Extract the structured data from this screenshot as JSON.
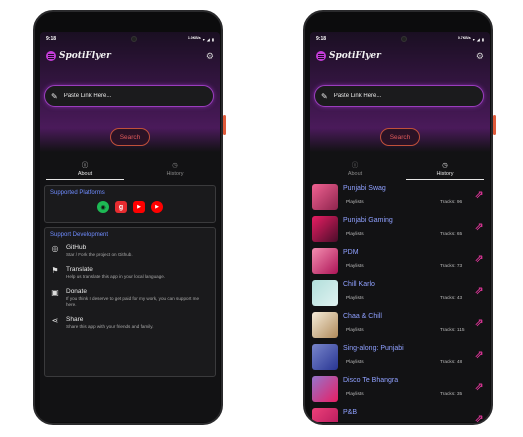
{
  "status_time": "9:18",
  "status_network": "1.0KB/s",
  "status_network_right": "0.7KB/s",
  "battery_icon": "battery-icon",
  "app_name": "SpotiFlyer",
  "search": {
    "placeholder": "Paste Link Here...",
    "button_label": "Search"
  },
  "tabs": {
    "about": "About",
    "history": "History"
  },
  "supported": {
    "title": "Supported Platforms",
    "platforms": [
      "spotify-icon",
      "gaana-icon",
      "youtube-icon",
      "youtube-music-icon"
    ]
  },
  "support_dev": {
    "title": "Support Development",
    "items": [
      {
        "name": "GitHub",
        "desc": "Star / Fork the project on Github."
      },
      {
        "name": "Translate",
        "desc": "Help us translate this app in your local language."
      },
      {
        "name": "Donate",
        "desc": "If you think I deserve to get paid for my work, you can support me here."
      },
      {
        "name": "Share",
        "desc": "Share this app with your friends and family."
      }
    ]
  },
  "history": [
    {
      "title": "Punjabi Swag",
      "type": "Playlists",
      "tracks": "Tracks: 96",
      "color": "#c2185b"
    },
    {
      "title": "Punjabi Gaming",
      "type": "Playlists",
      "tracks": "Tracks: 65",
      "color": "#d81b60"
    },
    {
      "title": "PDM",
      "type": "Playlists",
      "tracks": "Tracks: 73",
      "color": "#ec407a"
    },
    {
      "title": "Chill Karlo",
      "type": "Playlists",
      "tracks": "Tracks: 43",
      "color": "#80cbc4"
    },
    {
      "title": "Chaa & Chill",
      "type": "Playlists",
      "tracks": "Tracks: 115",
      "color": "#e8dcc8"
    },
    {
      "title": "Sing-along: Punjabi",
      "type": "Playlists",
      "tracks": "Tracks: 48",
      "color": "#5c6bc0"
    },
    {
      "title": "Disco Te Bhangra",
      "type": "Playlists",
      "tracks": "Tracks: 35",
      "color": "#7e57c2"
    },
    {
      "title": "P&B",
      "type": "",
      "tracks": "",
      "color": "#e91e63"
    }
  ]
}
